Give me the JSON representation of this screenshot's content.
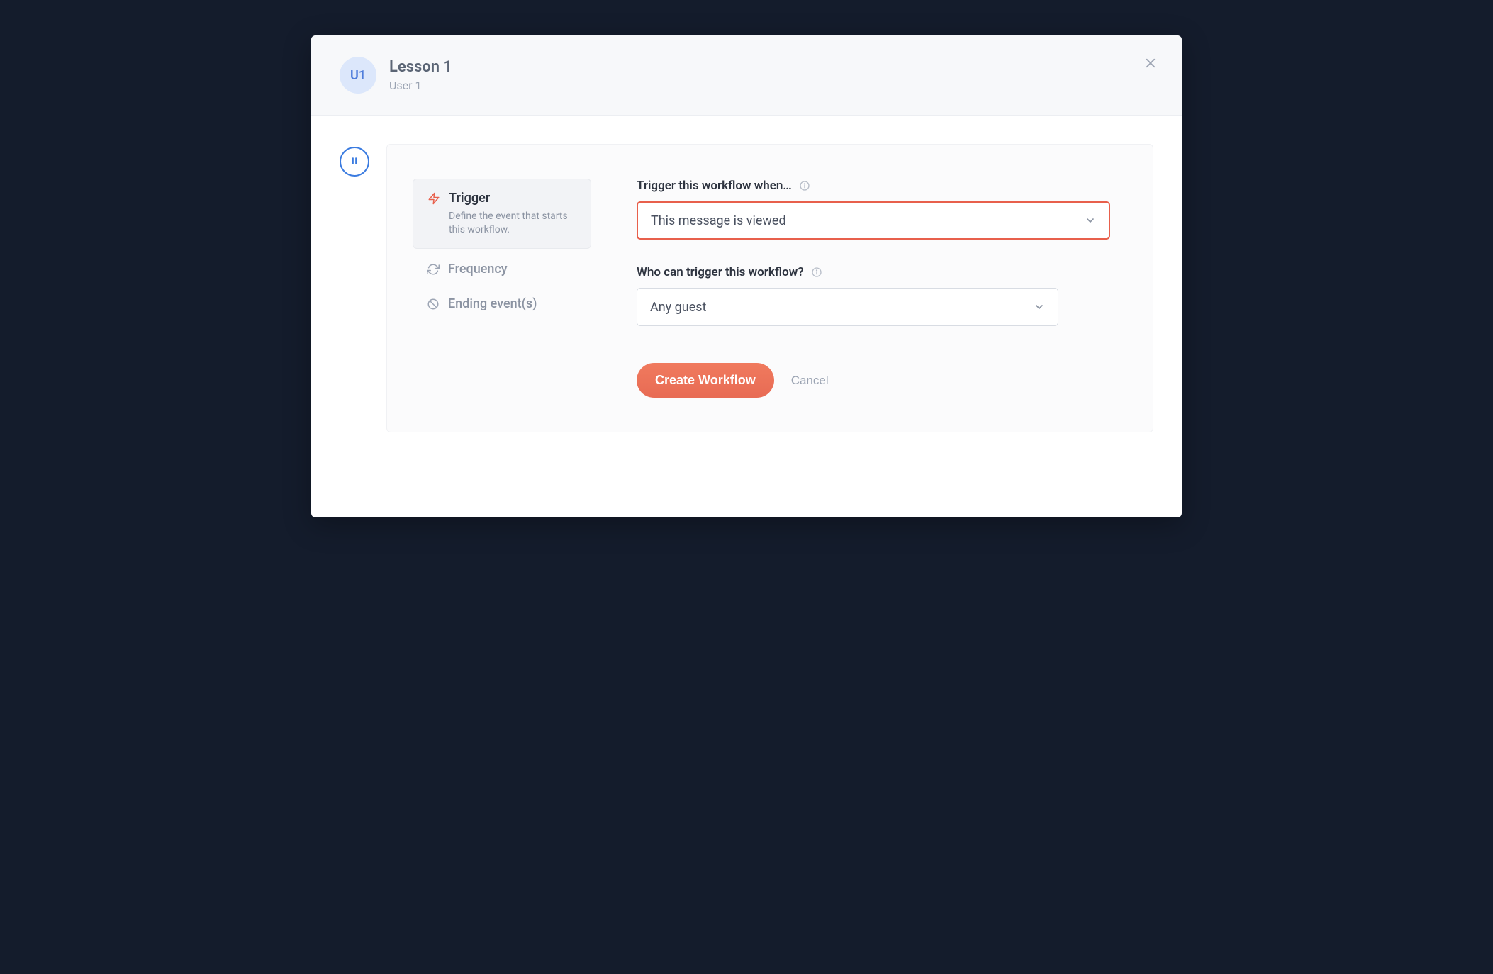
{
  "header": {
    "avatar_initials": "U1",
    "title": "Lesson 1",
    "subtitle": "User 1"
  },
  "side_nav": {
    "trigger": {
      "title": "Trigger",
      "description": "Define the event that starts this workflow."
    },
    "frequency": {
      "title": "Frequency"
    },
    "ending": {
      "title": "Ending event(s)"
    }
  },
  "form": {
    "trigger_label": "Trigger this workflow when…",
    "trigger_value": "This message is viewed",
    "who_label": "Who can trigger this workflow?",
    "who_value": "Any guest"
  },
  "actions": {
    "create": "Create Workflow",
    "cancel": "Cancel"
  }
}
